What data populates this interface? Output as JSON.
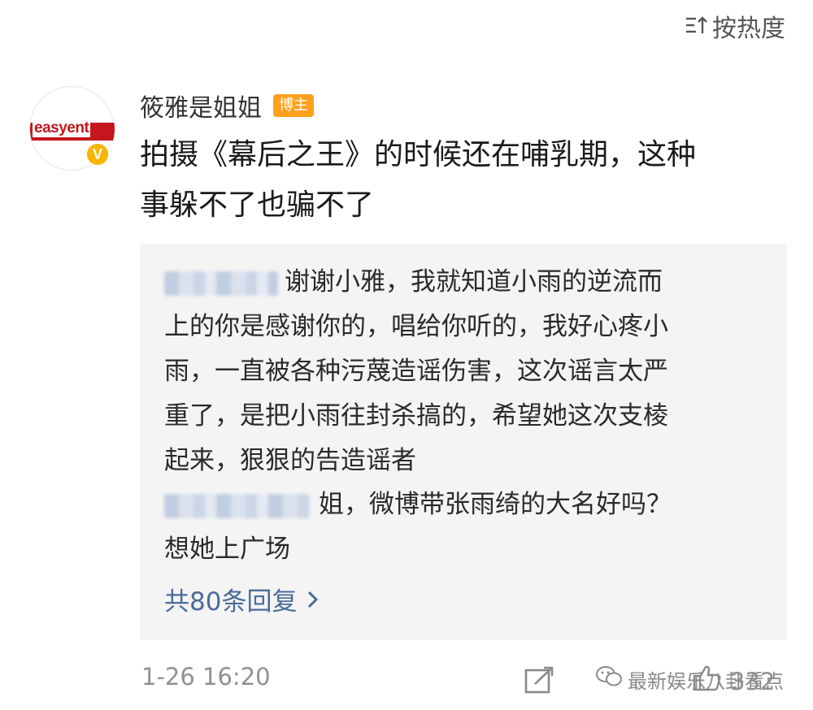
{
  "sort": {
    "label": "按热度"
  },
  "post": {
    "username": "筱雅是姐姐",
    "role_badge": "博主",
    "avatar_logo": "easyent",
    "verified_mark": "V",
    "comment_line1": "拍摄《幕后之王》的时候还在哺乳期，这种",
    "comment_line2": "事躲不了也骗不了"
  },
  "replies": {
    "items": [
      {
        "lines": [
          "谢谢小雅，我就知道小雨的逆流而",
          "上的你是感谢你的，唱给你听的，我好心疼小",
          "雨，一直被各种污蔑造谣伤害，这次谣言太严",
          "重了，是把小雨往封杀搞的，希望她这次支棱",
          "起来，狠狠的告造谣者"
        ]
      },
      {
        "lines": [
          "姐，微博带张雨绮的大名好吗？",
          "想她上广场"
        ]
      }
    ],
    "more_label": "共80条回复"
  },
  "footer": {
    "time": "1-26 16:20",
    "watermark": "最新娱乐八卦看点",
    "like_count": "332"
  },
  "colors": {
    "badge": "#ffa01c",
    "verified": "#f7b500",
    "link": "#4b6b9a",
    "reply_bg": "#f4f4f4"
  }
}
